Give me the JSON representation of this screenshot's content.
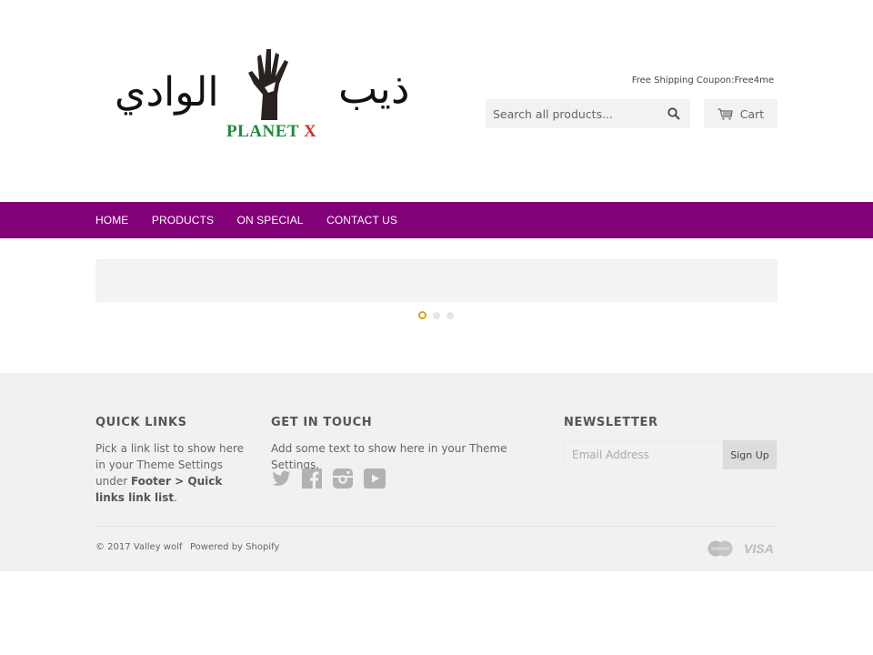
{
  "header": {
    "logo": {
      "arabic_left": "الوادي",
      "arabic_right": "ذيب",
      "brand_word": "PLANET",
      "brand_letter": "X",
      "icon": "hand-icon"
    },
    "coupon_text": "Free Shipping Coupon:Free4me",
    "search": {
      "placeholder": "Search all products...",
      "value": "",
      "icon": "search-icon"
    },
    "cart": {
      "label": "Cart",
      "icon": "cart-icon"
    }
  },
  "nav": {
    "items": [
      {
        "label": "HOME"
      },
      {
        "label": "PRODUCTS"
      },
      {
        "label": "ON SPECIAL"
      },
      {
        "label": "CONTACT US"
      }
    ],
    "background": "#820078"
  },
  "slideshow": {
    "slide_count": 3,
    "active_index": 0,
    "active_dot_color": "#d7a51e"
  },
  "footer": {
    "quick_links": {
      "title": "QUICK LINKS",
      "text_prefix": "Pick a link list to show here in your Theme Settings under ",
      "text_bold": "Footer > Quick links link list",
      "text_suffix": "."
    },
    "get_in_touch": {
      "title": "GET IN TOUCH",
      "text": "Add some text to show here in your Theme Settings.",
      "social": [
        "twitter-icon",
        "facebook-icon",
        "instagram-icon",
        "youtube-icon"
      ]
    },
    "newsletter": {
      "title": "NEWSLETTER",
      "placeholder": "Email Address",
      "value": "",
      "button_label": "Sign Up"
    },
    "copyright": "© 2017 Valley wolf",
    "powered_by": "Powered by Shopify",
    "payment": {
      "mastercard_label": "MasterCard",
      "visa_label": "VISA"
    }
  }
}
